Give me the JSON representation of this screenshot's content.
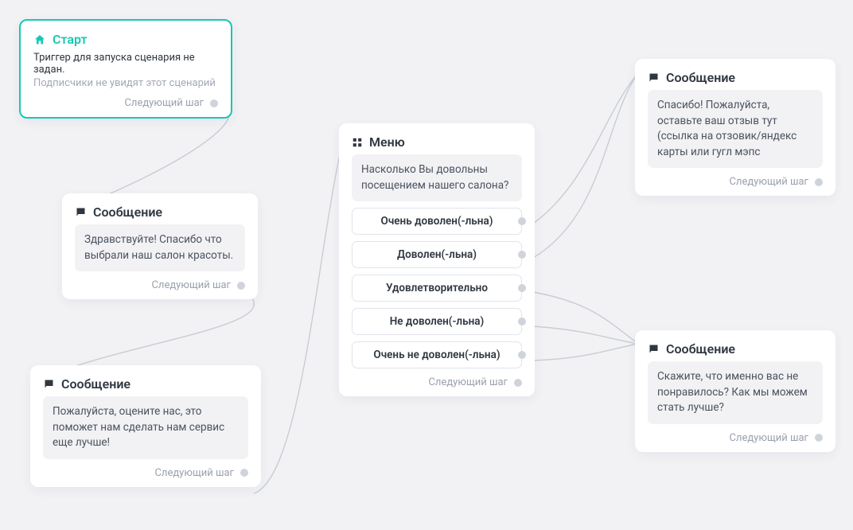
{
  "labels": {
    "next_step": "Следующий шаг"
  },
  "start": {
    "title": "Старт",
    "line1": "Триггер для запуска сценария не задан.",
    "line2": "Подписчики не увидят этот сценарий"
  },
  "msg1": {
    "title": "Сообщение",
    "body": "Здравствуйте! Спасибо что выбрали наш салон красоты."
  },
  "msg2": {
    "title": "Сообщение",
    "body": "Пожалуйста, оцените нас, это поможет нам сделать нам сервис еще лучше!"
  },
  "menu": {
    "title": "Меню",
    "prompt": "Насколько Вы довольны посещением нашего салона?",
    "options": [
      "Очень доволен(-льна)",
      "Доволен(-льна)",
      "Удовлетворительно",
      "Не доволен(-льна)",
      "Очень не доволен(-льна)"
    ]
  },
  "msg3": {
    "title": "Сообщение",
    "body": "Спасибо! Пожалуйста, оставьте ваш отзыв тут (ссылка на отзовик/яндекс карты или гугл мэпс"
  },
  "msg4": {
    "title": "Сообщение",
    "body": "Скажите, что именно вас не понравилось? Как мы можем стать лучше?"
  }
}
